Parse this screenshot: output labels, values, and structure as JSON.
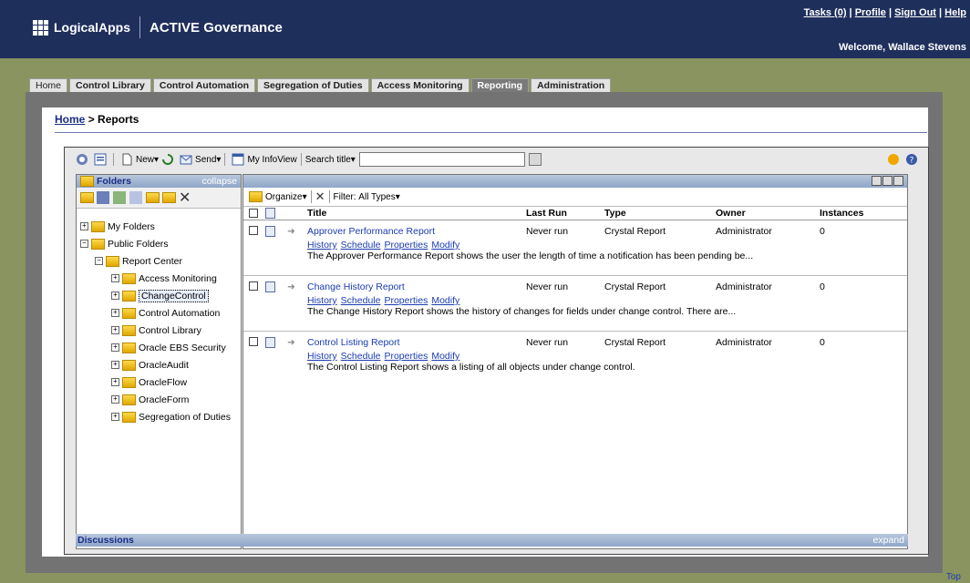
{
  "header": {
    "logo": "LogicalApps",
    "product": "ACTIVE Governance",
    "links": [
      "Tasks (0)",
      "Profile",
      "Sign Out",
      "Help"
    ],
    "welcome": "Welcome, Wallace Stevens"
  },
  "tabs": [
    "Home",
    "Control Library",
    "Control Automation",
    "Segregation of Duties",
    "Access Monitoring",
    "Reporting",
    "Administration"
  ],
  "breadcrumb": {
    "home": "Home",
    "current": "> Reports"
  },
  "toolbar": {
    "new_label": "New",
    "send_label": "Send",
    "myinfoview_label": "My InfoView",
    "searchtitle_label": "Search title"
  },
  "folders": {
    "title": "Folders",
    "collapse": "collapse",
    "tree": [
      "My Folders",
      "Public Folders",
      "Report Center",
      "Access Monitoring",
      "ChangeControl",
      "Control Automation",
      "Control Library",
      "Oracle EBS Security",
      "OracleAudit",
      "OracleFlow",
      "OracleForm",
      "Segregation of Duties"
    ]
  },
  "list": {
    "organize": "Organize",
    "filter_label": "Filter:",
    "filter_value": "All Types",
    "columns": [
      "Title",
      "Last Run",
      "Type",
      "Owner",
      "Instances"
    ],
    "row_links": [
      "History",
      "Schedule",
      "Properties",
      "Modify"
    ],
    "rows": [
      {
        "title": "Approver Performance Report",
        "last_run": "Never run",
        "type": "Crystal Report",
        "owner": "Administrator",
        "instances": "0",
        "desc": "The Approver Performance Report shows the user the length of time a notification has been pending be..."
      },
      {
        "title": "Change History Report",
        "last_run": "Never run",
        "type": "Crystal Report",
        "owner": "Administrator",
        "instances": "0",
        "desc": "The Change History Report shows the history of changes for fields under change control. There are..."
      },
      {
        "title": "Control Listing Report",
        "last_run": "Never run",
        "type": "Crystal Report",
        "owner": "Administrator",
        "instances": "0",
        "desc": "The Control Listing Report shows a listing of all objects under change control."
      }
    ]
  },
  "discussions": {
    "title": "Discussions",
    "expand": "expand"
  },
  "footer": {
    "top": "Top"
  }
}
